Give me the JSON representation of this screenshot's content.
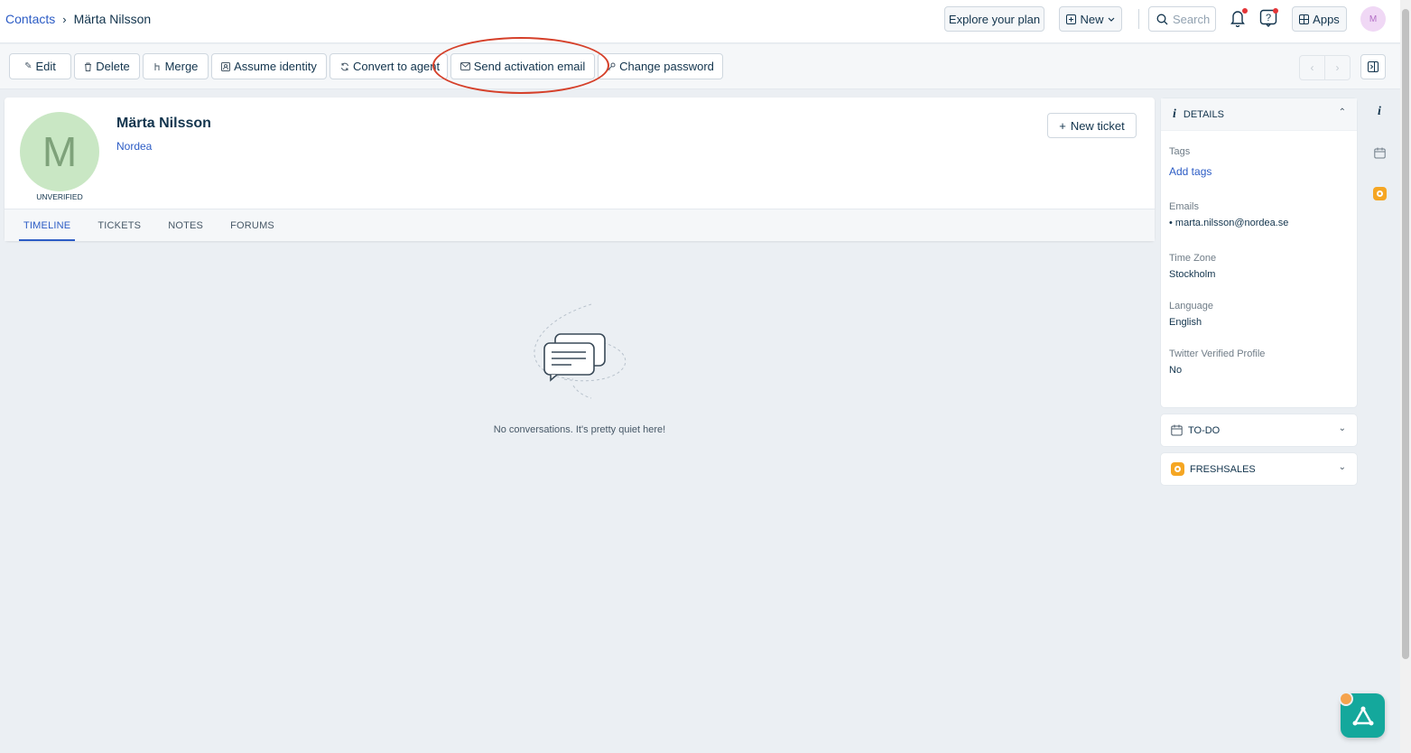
{
  "breadcrumb": {
    "parent": "Contacts",
    "separator": "›",
    "current": "Märta Nilsson"
  },
  "header": {
    "explore_label": "Explore your plan",
    "new_label": "New",
    "search_placeholder": "Search",
    "apps_label": "Apps",
    "user_initial": "M"
  },
  "toolbar": {
    "edit": "Edit",
    "delete": "Delete",
    "merge": "Merge",
    "assume_identity": "Assume identity",
    "convert_to_agent": "Convert to agent",
    "send_activation_email": "Send activation email",
    "change_password": "Change password"
  },
  "contact": {
    "initial": "M",
    "status": "UNVERIFIED",
    "name": "Märta Nilsson",
    "company": "Nordea",
    "new_ticket_label": "New ticket"
  },
  "tabs": [
    "TIMELINE",
    "TICKETS",
    "NOTES",
    "FORUMS"
  ],
  "empty_state": {
    "message": "No conversations. It's pretty quiet here!"
  },
  "details": {
    "title": "DETAILS",
    "tags_label": "Tags",
    "tags_action": "Add tags",
    "emails_label": "Emails",
    "email": "marta.nilsson@nordea.se",
    "timezone_label": "Time Zone",
    "timezone": "Stockholm",
    "language_label": "Language",
    "language": "English",
    "twitter_label": "Twitter Verified Profile",
    "twitter": "No"
  },
  "panels": {
    "todo": "TO-DO",
    "freshsales": "FRESHSALES"
  },
  "colors": {
    "accent": "#2c5cc5",
    "highlight": "#d5402a",
    "fab": "#14a89c"
  }
}
